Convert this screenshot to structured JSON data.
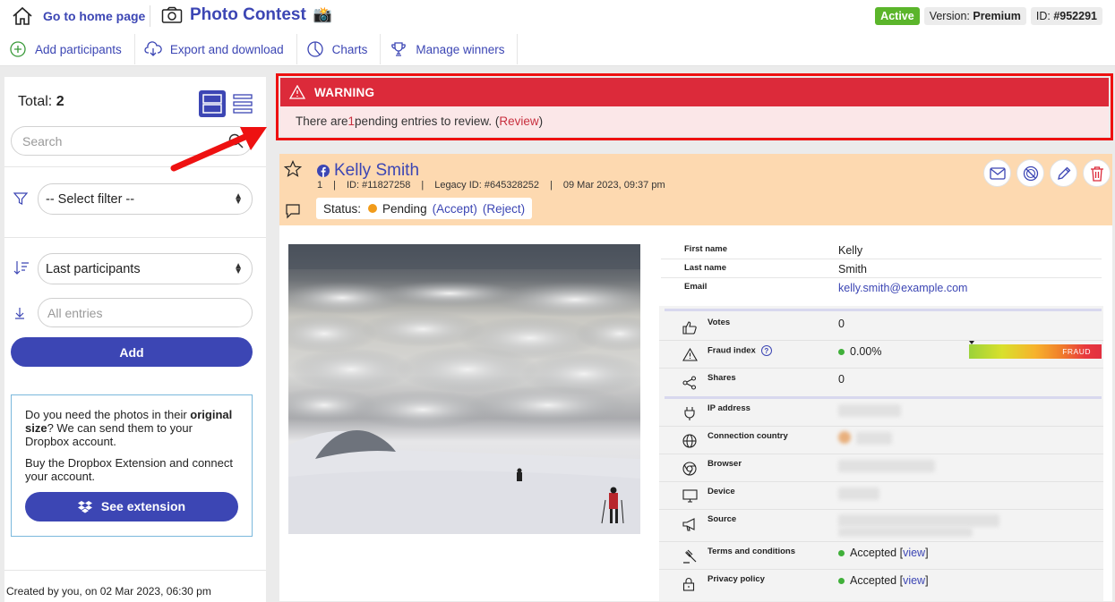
{
  "header": {
    "home_label": "Go to home page",
    "contest_title": "Photo Contest",
    "contest_emoji": "📸",
    "status_badge": "Active",
    "version_label": "Version:",
    "version_value": "Premium",
    "id_label": "ID:",
    "id_value": "#952291"
  },
  "toolbar": {
    "add_participants": "Add participants",
    "export": "Export and download",
    "charts": "Charts",
    "manage_winners": "Manage winners"
  },
  "sidebar": {
    "total_label": "Total:",
    "total_value": "2",
    "search_placeholder": "Search",
    "filter_value": "-- Select filter --",
    "sort_value": "Last participants",
    "entries_placeholder": "All entries",
    "add_label": "Add",
    "dropbox": {
      "text1_a": "Do you need the photos in their ",
      "text1_b": "original size",
      "text1_c": "? We can send them to your Dropbox account.",
      "text2": "Buy the Dropbox Extension and connect your account.",
      "button": "See extension"
    },
    "created": "Created by you, on 02 Mar 2023, 06:30 pm"
  },
  "warning": {
    "title": "WARNING",
    "text_before": "There are ",
    "count": "1",
    "text_after": " pending entries to review. (",
    "link": "Review",
    "close_paren": ")"
  },
  "entry": {
    "name": "Kelly Smith",
    "number": "1",
    "id": "ID: #11827258",
    "legacy_id": "Legacy ID: #645328252",
    "date": "09 Mar 2023, 09:37 pm",
    "status_label": "Status:",
    "status_value": "Pending",
    "accept": "(Accept)",
    "reject": "(Reject)",
    "details": [
      {
        "label": "First name",
        "value": "Kelly"
      },
      {
        "label": "Last name",
        "value": "Smith"
      },
      {
        "label": "Email",
        "value": "kelly.smith@example.com"
      }
    ],
    "stats": {
      "votes_label": "Votes",
      "votes_value": "0",
      "fraud_label": "Fraud index",
      "fraud_value": "0.00%",
      "fraud_bar_label": "FRAUD",
      "fraud_level": 0.0,
      "shares_label": "Shares",
      "shares_value": "0",
      "ip_label": "IP address",
      "country_label": "Connection country",
      "browser_label": "Browser",
      "device_label": "Device",
      "source_label": "Source",
      "terms_label": "Terms and conditions",
      "terms_value": "Accepted [",
      "terms_link": "view",
      "terms_close": "]",
      "privacy_label": "Privacy policy",
      "privacy_value": "Accepted [",
      "privacy_link": "view",
      "privacy_close": "]"
    }
  },
  "colors": {
    "brand": "#3c46b4",
    "warning_red": "#dc2a3a",
    "pending_orange": "#f19b1a",
    "card_header": "#fdd9b0",
    "active_green": "#5bb52b"
  }
}
